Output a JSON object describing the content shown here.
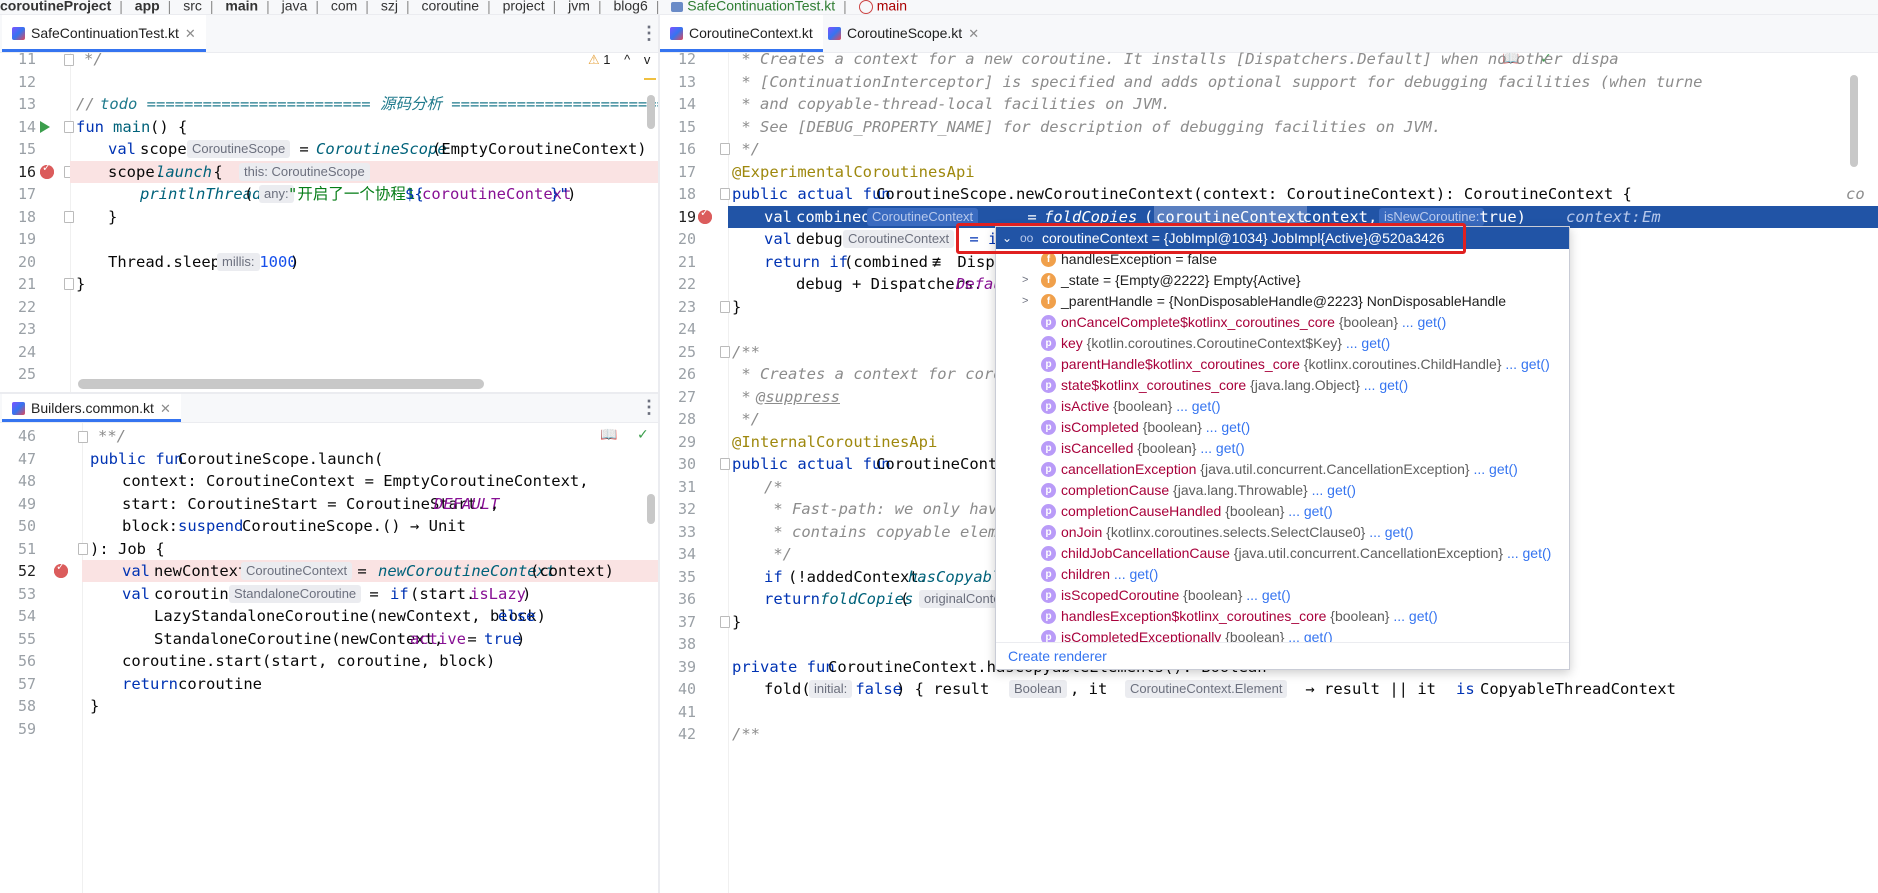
{
  "breadcrumb": [
    "coroutineProject",
    "app",
    "src",
    "main",
    "java",
    "com",
    "szj",
    "coroutine",
    "project",
    "jvm",
    "blog6",
    "SafeContinuationTest.kt",
    "main"
  ],
  "left_top": {
    "tab": "SafeContinuationTest.kt",
    "warnings": "1",
    "lines": [
      {
        "n": "11",
        "html": "*/"
      },
      {
        "n": "12",
        "html": ""
      },
      {
        "n": "13",
        "html": "// todo ======================== 源码分析 ============================="
      },
      {
        "n": "14",
        "html": "fun main() {"
      },
      {
        "n": "15",
        "html": "    val scope CoroutineScope = CoroutineScope(EmptyCoroutineContext)"
      },
      {
        "n": "16",
        "html": "    scope.launch { this: CoroutineScope"
      },
      {
        "n": "17",
        "html": "        printlnThread( any: \"开启了一个协程1:${coroutineContext}\")"
      },
      {
        "n": "18",
        "html": "    }"
      },
      {
        "n": "19",
        "html": ""
      },
      {
        "n": "20",
        "html": "    Thread.sleep( millis: 1000)"
      },
      {
        "n": "21",
        "html": "}"
      },
      {
        "n": "22",
        "html": ""
      },
      {
        "n": "23",
        "html": ""
      },
      {
        "n": "24",
        "html": ""
      },
      {
        "n": "25",
        "html": ""
      }
    ],
    "t": {
      "l11": "*/",
      "l13a": "// ",
      "l13b": "todo ======================== 源码分析 =============================",
      "l14a": "fun ",
      "l14b": "main",
      "l14c": "() {",
      "l15a": "val ",
      "l15b": "scope",
      "l15h": "CoroutineScope",
      "l15c": " = ",
      "l15d": "CoroutineScope",
      "l15e": "(EmptyCoroutineContext)",
      "l16a": "scope.",
      "l16b": "launch",
      "l16c": " { ",
      "l16h": "this: CoroutineScope",
      "l17a": "printlnThread",
      "l17b": "( ",
      "l17h": "any:",
      "l17c": "\"开启了一个协程1:",
      "l17d": "${",
      "l17e": "coroutineContext",
      "l17f": "}\"",
      "l17g": ")",
      "l18": "}",
      "l20a": "Thread.sleep( ",
      "l20h": "millis:",
      "l20b": " 1000",
      "l20c": ")",
      "l21": "}"
    }
  },
  "left_bottom": {
    "tab": "Builders.common.kt",
    "numbers": [
      "46",
      "47",
      "48",
      "49",
      "50",
      "51",
      "52",
      "53",
      "54",
      "55",
      "56",
      "57",
      "58",
      "59"
    ],
    "t": {
      "l46": "**/",
      "l47a": "public fun ",
      "l47b": "CoroutineScope.launch(",
      "l48": "context: CoroutineContext = EmptyCoroutineContext,",
      "l49a": "start: CoroutineStart = CoroutineStart.",
      "l49b": "DEFAULT",
      "l49c": ",",
      "l50a": "block: ",
      "l50b": "suspend ",
      "l50c": "CoroutineScope.() → Unit",
      "l51": "): Job {",
      "l52a": "val ",
      "l52b": "newContext",
      "l52h": "CoroutineContext",
      "l52c": " = ",
      "l52d": "newCoroutineContext",
      "l52e": "(context)",
      "l53a": "val ",
      "l53b": "coroutine",
      "l53h": "StandaloneCoroutine",
      "l53c": " = ",
      "l53d": "if ",
      "l53e": "(start.",
      "l53f": "isLazy",
      "l53g": ")",
      "l54a": "LazyStandaloneCoroutine(newContext, block) ",
      "l54b": "else",
      "l55a": "StandaloneCoroutine(newContext, ",
      "l55b": "active",
      "l55c": " = ",
      "l55d": "true",
      "l55e": ")",
      "l56": "coroutine.start(start, coroutine, block)",
      "l57a": "return ",
      "l57b": "coroutine",
      "l58": "}"
    }
  },
  "right": {
    "tabs": [
      "CoroutineContext.kt",
      "CoroutineScope.kt"
    ],
    "numbers": [
      "12",
      "13",
      "14",
      "15",
      "16",
      "17",
      "18",
      "19",
      "20",
      "21",
      "22",
      "23",
      "24",
      "25",
      "26",
      "27",
      "28",
      "29",
      "30",
      "31",
      "32",
      "33",
      "34",
      "35",
      "36",
      "37",
      "38",
      "39",
      "40",
      "41",
      "42"
    ],
    "t": {
      "l12": " * Creates a context for a new coroutine. It installs [Dispatchers.Default] when no other dispa",
      "l13": " * [ContinuationInterceptor] is specified and adds optional support for debugging facilities (when turne",
      "l14": " * and copyable-thread-local facilities on JVM.",
      "l15": " * See [DEBUG_PROPERTY_NAME] for description of debugging facilities on JVM.",
      "l16": " */",
      "l17": "@ExperimentalCoroutinesApi",
      "l18a": "public actual fun ",
      "l18b": "CoroutineScope.newCoroutineContext(context: CoroutineContext): CoroutineContext {",
      "l18c": "co",
      "l19a": "val ",
      "l19b": "combined",
      "l19h": "CoroutineContext",
      "l19c": " = ",
      "l19d": "foldCopies",
      "l19e": "(",
      "l19f": "coroutineContext",
      "l19g": ", context, ",
      "l19i": "isNewCoroutine:",
      "l19j": " true)",
      "l19k": "context:",
      "l19l": "Em",
      "l20a": "val ",
      "l20b": "debug",
      "l20h": "CoroutineContext",
      "l20c": " = if",
      "l21a": "return if ",
      "l21b": "(combined ",
      "l21c": "≢",
      "l21d": " Dispa",
      "l22a": "debug + Dispatchers.",
      "l22b": "Defau",
      "l23": "}",
      "l25": "/**",
      "l26": " * Creates a context for coroutin",
      "l27a": " * ",
      "l27b": "@suppress",
      "l28": " */",
      "l29": "@InternalCoroutinesApi",
      "l30a": "public actual fun ",
      "l30b": "CoroutineContex",
      "l31": "/*",
      "l32": " * Fast-path: we only have to",
      "l33": " * contains copyable elements",
      "l34": " */",
      "l35a": "if ",
      "l35b": "(!addedContext.",
      "l35c": "hasCopyable",
      "l36a": "return ",
      "l36b": "foldCopies",
      "l36c": "( ",
      "l36h": "originalContex",
      "l37": "}",
      "l39a": "private fun ",
      "l39b": "CoroutineContext.hasCopyableElements(): Boolean =",
      "l40a": "fold( ",
      "l40h": "initial:",
      "l40b": " false",
      "l40c": ") { result ",
      "l40h2": "Boolean",
      "l40d": ", it ",
      "l40h3": "CoroutineContext.Element",
      "l40e": " → result || it ",
      "l40f": "is ",
      "l40g": "CopyableThreadContext",
      "l42": "/**"
    }
  },
  "debugger": {
    "header": "coroutineContext = {JobImpl@1034} JobImpl{Active}@520a3426",
    "rows": [
      {
        "badge": "f",
        "name": "handlesException",
        "type": "",
        "value": " = false",
        "get": "",
        "expand": false
      },
      {
        "badge": "f",
        "name": "_state",
        "type": "",
        "value": " = {Empty@2222} Empty{Active}",
        "get": "",
        "expand": true
      },
      {
        "badge": "f",
        "name": "_parentHandle",
        "type": "",
        "value": " = {NonDisposableHandle@2223} NonDisposableHandle",
        "get": "",
        "expand": true
      },
      {
        "badge": "p",
        "name": "onCancelComplete$kotlinx_coroutines_core",
        "type": " {boolean}",
        "value": "",
        "get": " ... get()",
        "expand": false
      },
      {
        "badge": "p",
        "name": "key",
        "type": " {kotlin.coroutines.CoroutineContext$Key}",
        "value": "",
        "get": " ... get()",
        "expand": false
      },
      {
        "badge": "p",
        "name": "parentHandle$kotlinx_coroutines_core",
        "type": " {kotlinx.coroutines.ChildHandle}",
        "value": "",
        "get": " ... get()",
        "expand": false
      },
      {
        "badge": "p",
        "name": "state$kotlinx_coroutines_core",
        "type": " {java.lang.Object}",
        "value": "",
        "get": " ... get()",
        "expand": false
      },
      {
        "badge": "p",
        "name": "isActive",
        "type": " {boolean}",
        "value": "",
        "get": " ... get()",
        "expand": false
      },
      {
        "badge": "p",
        "name": "isCompleted",
        "type": " {boolean}",
        "value": "",
        "get": " ... get()",
        "expand": false
      },
      {
        "badge": "p",
        "name": "isCancelled",
        "type": " {boolean}",
        "value": "",
        "get": " ... get()",
        "expand": false
      },
      {
        "badge": "p",
        "name": "cancellationException",
        "type": " {java.util.concurrent.CancellationException}",
        "value": "",
        "get": " ... get()",
        "expand": false
      },
      {
        "badge": "p",
        "name": "completionCause",
        "type": " {java.lang.Throwable}",
        "value": "",
        "get": " ... get()",
        "expand": false
      },
      {
        "badge": "p",
        "name": "completionCauseHandled",
        "type": " {boolean}",
        "value": "",
        "get": " ... get()",
        "expand": false
      },
      {
        "badge": "p",
        "name": "onJoin",
        "type": " {kotlinx.coroutines.selects.SelectClause0}",
        "value": "",
        "get": " ... get()",
        "expand": false
      },
      {
        "badge": "p",
        "name": "childJobCancellationCause",
        "type": " {java.util.concurrent.CancellationException}",
        "value": "",
        "get": " ... get()",
        "expand": false
      },
      {
        "badge": "p",
        "name": "children",
        "type": "",
        "value": "",
        "get": " ... get()",
        "expand": false
      },
      {
        "badge": "p",
        "name": "isScopedCoroutine",
        "type": " {boolean}",
        "value": "",
        "get": " ... get()",
        "expand": false
      },
      {
        "badge": "p",
        "name": "handlesException$kotlinx_coroutines_core",
        "type": " {boolean}",
        "value": "",
        "get": " ... get()",
        "expand": false
      },
      {
        "badge": "p",
        "name": "isCompletedExceptionally",
        "type": " {boolean}",
        "value": "",
        "get": " ... get()",
        "expand": false
      }
    ],
    "footer": "Create renderer",
    "header_arrow": "⌄",
    "header_icon": "oo"
  },
  "icons": {
    "kebab": "⋮",
    "close": "✕",
    "reader": "📖",
    "check": "✓",
    "warning": "⚠",
    "up": "^",
    "down": "v"
  },
  "colors": {
    "accent": "#3574f0",
    "breakpoint": "#db5c5c",
    "execution_line": "#2154a6",
    "highlight_box": "#e02020"
  }
}
